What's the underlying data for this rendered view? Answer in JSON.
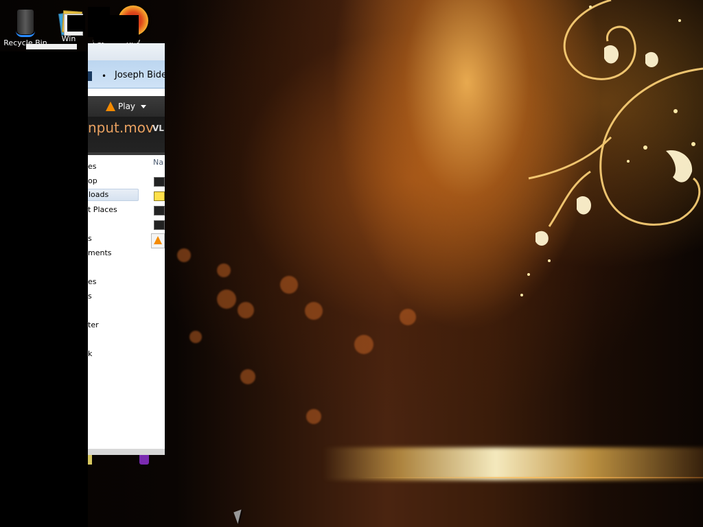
{
  "desktop": {
    "icons": [
      {
        "label": "Recycle Bin",
        "icon": "recycle-bin-icon"
      },
      {
        "label": "Win",
        "icon": "folder-stack-icon"
      },
      {
        "label": "Las",
        "icon": "generic-icon"
      },
      {
        "label": "Rev",
        "icon": "browser-icon"
      }
    ]
  },
  "window": {
    "breadcrumb_separator": "•",
    "breadcrumb": "Joseph Bide",
    "toolbar": {
      "play_label": "Play"
    },
    "title": {
      "filename": "nput.mov",
      "app_tag": "VL"
    },
    "nav_items": [
      {
        "label": "es"
      },
      {
        "label": "op"
      },
      {
        "label": "loads",
        "selected": true
      },
      {
        "label": "t Places"
      },
      {
        "label": "s"
      },
      {
        "label": "ments"
      },
      {
        "label": "es"
      },
      {
        "label": "s"
      },
      {
        "label": "ter"
      },
      {
        "label": "k"
      }
    ],
    "column_header": "Na"
  },
  "colors": {
    "vlc_orange": "#f48a00",
    "selection_blue": "#d6e2f0",
    "address_bar": "#bcd6f0"
  }
}
